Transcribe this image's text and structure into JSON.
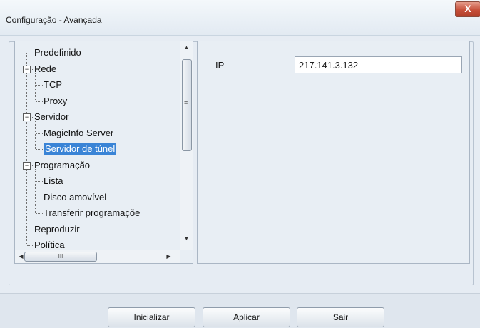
{
  "window": {
    "title": "Configuração - Avançada",
    "close_label": "X"
  },
  "tree": {
    "items": [
      {
        "label": "Predefinido",
        "level": 0,
        "expander": ""
      },
      {
        "label": "Rede",
        "level": 0,
        "expander": "−"
      },
      {
        "label": "TCP",
        "level": 1,
        "expander": ""
      },
      {
        "label": "Proxy",
        "level": 1,
        "expander": ""
      },
      {
        "label": "Servidor",
        "level": 0,
        "expander": "−"
      },
      {
        "label": "MagicInfo Server",
        "level": 1,
        "expander": ""
      },
      {
        "label": "Servidor de túnel",
        "level": 1,
        "expander": "",
        "selected": true
      },
      {
        "label": "Programação",
        "level": 0,
        "expander": "−"
      },
      {
        "label": "Lista",
        "level": 1,
        "expander": ""
      },
      {
        "label": "Disco amovível",
        "level": 1,
        "expander": ""
      },
      {
        "label": "Transferir programaçõe",
        "level": 1,
        "expander": ""
      },
      {
        "label": "Reproduzir",
        "level": 0,
        "expander": ""
      },
      {
        "label": "Política",
        "level": 0,
        "expander": ""
      }
    ],
    "scroll_up_icon": "▲",
    "scroll_down_icon": "▼",
    "scroll_left_icon": "◀",
    "scroll_right_icon": "▶",
    "vthumb_grip": "≡",
    "hthumb_grip": "III"
  },
  "detail": {
    "ip_label": "IP",
    "ip_value": "217.141.3.132"
  },
  "buttons": {
    "reset": "Inicializar",
    "apply": "Aplicar",
    "exit": "Sair"
  }
}
